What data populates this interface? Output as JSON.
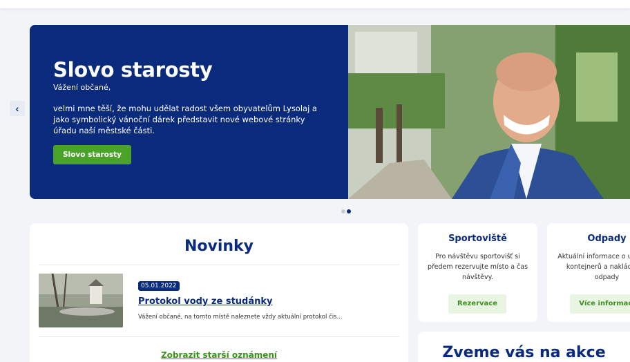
{
  "hero": {
    "title": "Slovo starosty",
    "greeting": "Vážení občané,",
    "body": "velmi mne těší, že mohu udělat radost všem obyvatelům Lysolaj a jako symbolický vánoční dárek představit nové webové stránky úřadu naší městské části.",
    "cta": "Slovo starosty",
    "prev_icon": "‹",
    "slide_count": 2,
    "active_slide": 2
  },
  "news": {
    "heading": "Novinky",
    "items": [
      {
        "date": "05.01.2022",
        "title": "Protokol vody ze studánky",
        "excerpt": "Vážení občané, na tomto místě naleznete vždy aktuální protokol čis..."
      }
    ],
    "more_label": "Zobrazit starší oznámení"
  },
  "cards": [
    {
      "title": "Sportoviště",
      "text": "Pro návštěvu sportovišť si předem rezervujte místo a čas návštěvy.",
      "button": "Rezervace"
    },
    {
      "title": "Odpady",
      "text": "Aktuální informace o umístění kontejnerů a nakládání s odpady",
      "button": "Více informací"
    }
  ],
  "events": {
    "heading": "Zveme vás na akce"
  },
  "colors": {
    "brand": "#0a2a7c",
    "accent": "#4aa329",
    "background": "#f3f4f8"
  }
}
